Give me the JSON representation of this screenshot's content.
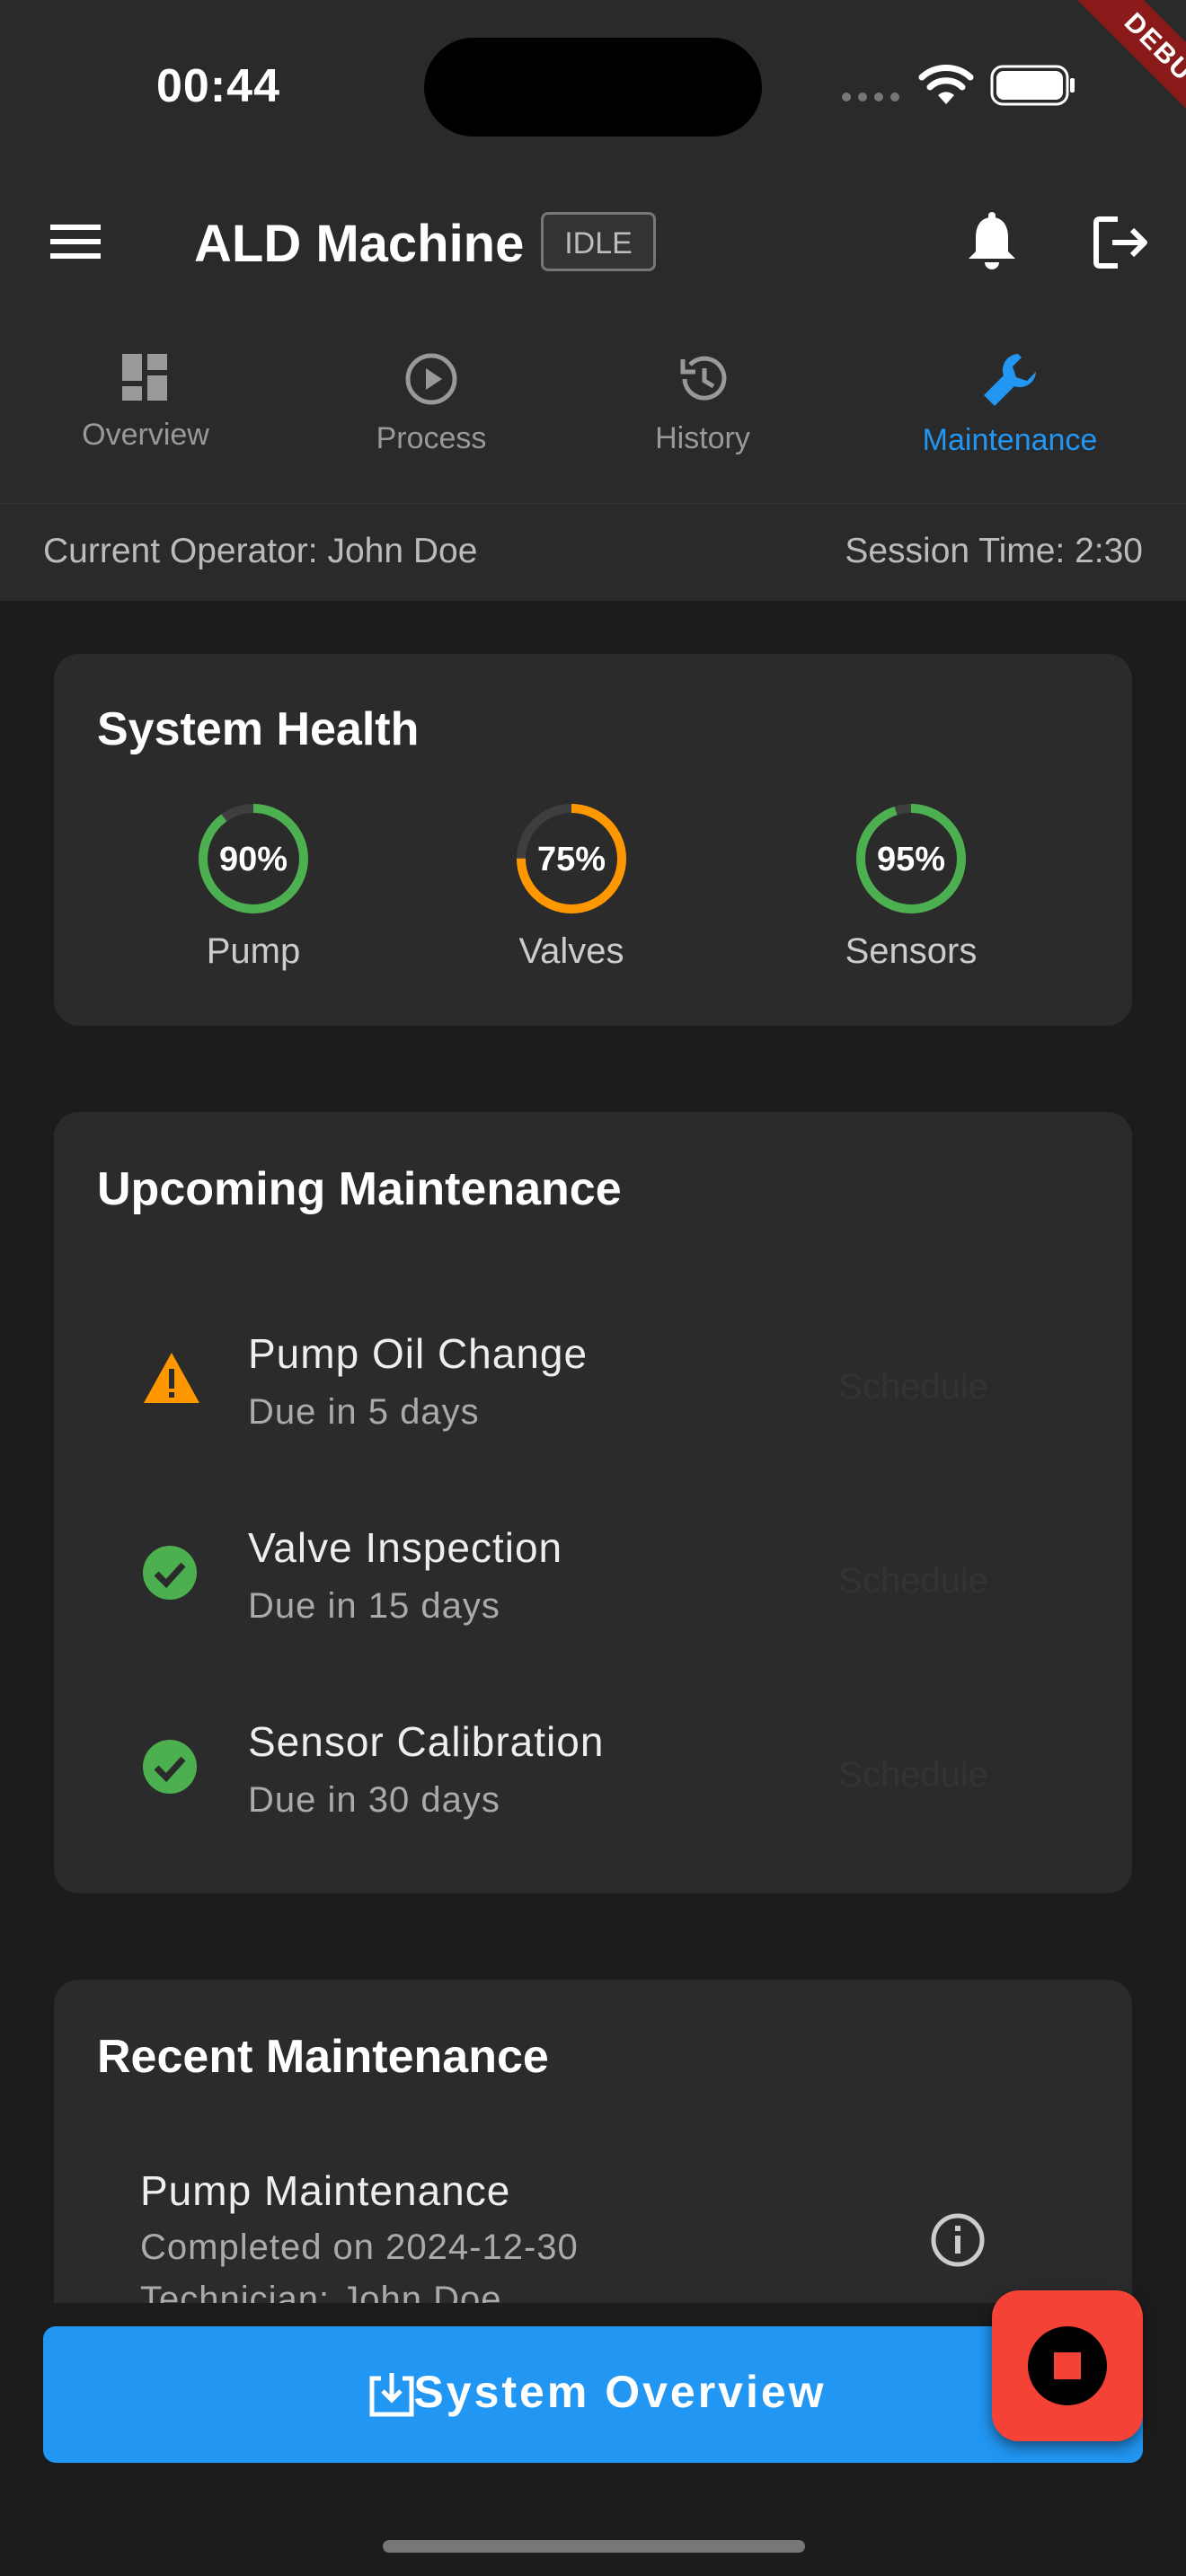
{
  "status_bar": {
    "time": "00:44",
    "debug_label": "DEBUG"
  },
  "app_bar": {
    "title": "ALD Machine",
    "state_badge": "IDLE",
    "menu_icon": "menu-icon",
    "notification_icon": "bell-icon",
    "logout_icon": "logout-icon"
  },
  "tabs": [
    {
      "label": "Overview",
      "icon": "dashboard-icon",
      "active": false
    },
    {
      "label": "Process",
      "icon": "play-circle-icon",
      "active": false
    },
    {
      "label": "History",
      "icon": "history-icon",
      "active": false
    },
    {
      "label": "Maintenance",
      "icon": "wrench-icon",
      "active": true
    }
  ],
  "operator_bar": {
    "operator": "Current Operator: John Doe",
    "session": "Session Time: 2:30"
  },
  "system_health": {
    "title": "System Health",
    "gauges": [
      {
        "label": "Pump",
        "value_text": "90%",
        "value": 0.9,
        "color": "#4caf50"
      },
      {
        "label": "Valves",
        "value_text": "75%",
        "value": 0.75,
        "color": "#ff9800"
      },
      {
        "label": "Sensors",
        "value_text": "95%",
        "value": 0.95,
        "color": "#4caf50"
      }
    ]
  },
  "upcoming": {
    "title": "Upcoming Maintenance",
    "items": [
      {
        "title": "Pump Oil Change",
        "due": "Due in 5 days",
        "status_icon": "warning-icon",
        "action": "Schedule"
      },
      {
        "title": "Valve Inspection",
        "due": "Due in 15 days",
        "status_icon": "check-circle-icon",
        "action": "Schedule"
      },
      {
        "title": "Sensor Calibration",
        "due": "Due in 30 days",
        "status_icon": "check-circle-icon",
        "action": "Schedule"
      }
    ]
  },
  "recent": {
    "title": "Recent Maintenance",
    "items": [
      {
        "title": "Pump Maintenance",
        "completed": "Completed on 2024-12-30",
        "technician": "Technician: John Doe"
      }
    ]
  },
  "bottom": {
    "primary_button": "System Overview"
  },
  "colors": {
    "accent": "#2196f3",
    "warning": "#ff9800",
    "ok": "#4caf50",
    "stop": "#f44336",
    "card": "#2b2b2b",
    "background": "#1c1c1c"
  }
}
